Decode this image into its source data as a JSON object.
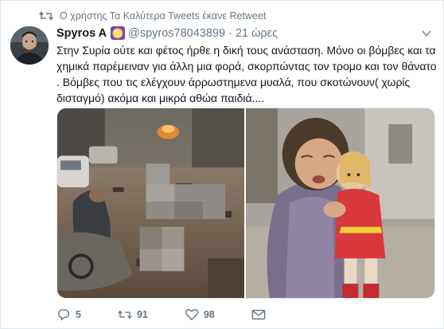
{
  "retweet_context": {
    "text": "Ο χρήστης Τα Καλύτερα Tweets έκανε Retweet",
    "icon": "retweet-icon"
  },
  "author": {
    "name": "Spyros A",
    "badge": "♋",
    "handle": "@spyros78043899",
    "separator": "·",
    "time": "21 ώρες"
  },
  "tweet": {
    "line1": "Στην Συρία  ούτε και φέτος ήρθε η δική τους ανάσταση. Μόνο οι βόμβες και  τα",
    "line2": "χημικά  παρέμειναν για άλλη μια φορά, σκορπώντας τον τρομο και τον θάνατο",
    "line3": ". Βόμβες που τις ελέγχουν άρρωστημενα μυαλά, που  σκοτώνουν( χωρίς",
    "line4": "δισταγμό) ακόμα και μικρά αθώα παιδιά...."
  },
  "media": {
    "left_icon": "photo-bombed-street",
    "right_icon": "photo-crying-child-with-doll"
  },
  "actions": {
    "reply_count": "5",
    "retweet_count": "91",
    "like_count": "98"
  },
  "colors": {
    "text": "#14171a",
    "muted": "#657786",
    "border": "#e1e8ed",
    "badge": "#7a3fc1"
  }
}
